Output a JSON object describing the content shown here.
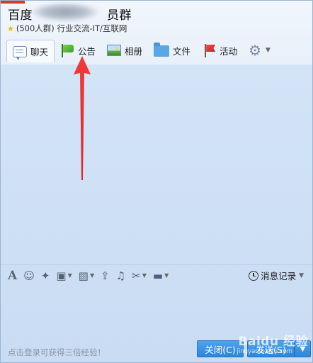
{
  "titlebar": {
    "group_name": "百度　　　　　　员群",
    "group_info": "(500人群) 行业交流-IT/互联网"
  },
  "tabs": [
    {
      "label": "聊天",
      "icon": "chat-icon"
    },
    {
      "label": "公告",
      "icon": "announcement-flag-icon"
    },
    {
      "label": "相册",
      "icon": "album-icon"
    },
    {
      "label": "文件",
      "icon": "folder-icon"
    },
    {
      "label": "活动",
      "icon": "activity-flag-icon"
    }
  ],
  "toolbar": {
    "history_label": "消息记录",
    "tools": [
      "font-icon",
      "emoji-icon",
      "magic-icon",
      "gift-icon",
      "image-icon",
      "upload-icon",
      "music-icon",
      "scissors-icon",
      "screen-icon"
    ]
  },
  "footer": {
    "hint": "点击登录可获得三倍经验！",
    "close_label": "关闭(C)",
    "send_label": "发送(S)"
  },
  "watermark": {
    "text": "Baidu 经验",
    "sub": "jingyan.baidu.com"
  },
  "colors": {
    "accent": "#2c86db",
    "arrow": "#e8313a",
    "star": "#f2b705"
  }
}
